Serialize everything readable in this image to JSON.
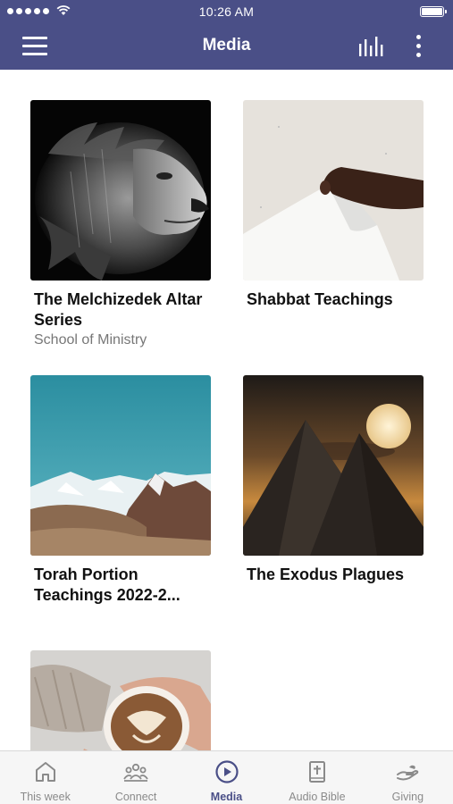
{
  "status_bar": {
    "time": "10:26 AM",
    "signal_dots": 5
  },
  "header": {
    "title": "Media",
    "menu_icon": "hamburger-menu-icon",
    "audio_icon": "audio-bars-icon",
    "more_icon": "more-vertical-icon",
    "background_color": "#4a4f87"
  },
  "media": {
    "items": [
      {
        "title": "The Melchizedek Altar Series",
        "subtitle": "School of Ministry",
        "image": "black-and-white lion portrait"
      },
      {
        "title": "Shabbat Teachings",
        "subtitle": "",
        "image": "hand turning a white page"
      },
      {
        "title": "Torah Portion Teachings 2022-2...",
        "subtitle": "",
        "image": "snowy mountains under teal sky"
      },
      {
        "title": "The Exodus Plagues",
        "subtitle": "",
        "image": "pyramids under a full moon"
      },
      {
        "title": "",
        "subtitle": "",
        "image": "latte art coffee cup in hands"
      }
    ]
  },
  "tab_bar": {
    "active_color": "#4a4f87",
    "inactive_color": "#8a8a8a",
    "tabs": [
      {
        "label": "This week",
        "icon": "home-icon",
        "active": false
      },
      {
        "label": "Connect",
        "icon": "group-icon",
        "active": false
      },
      {
        "label": "Media",
        "icon": "play-circle-icon",
        "active": true
      },
      {
        "label": "Audio Bible",
        "icon": "bible-icon",
        "active": false
      },
      {
        "label": "Giving",
        "icon": "giving-hand-icon",
        "active": false
      }
    ]
  }
}
